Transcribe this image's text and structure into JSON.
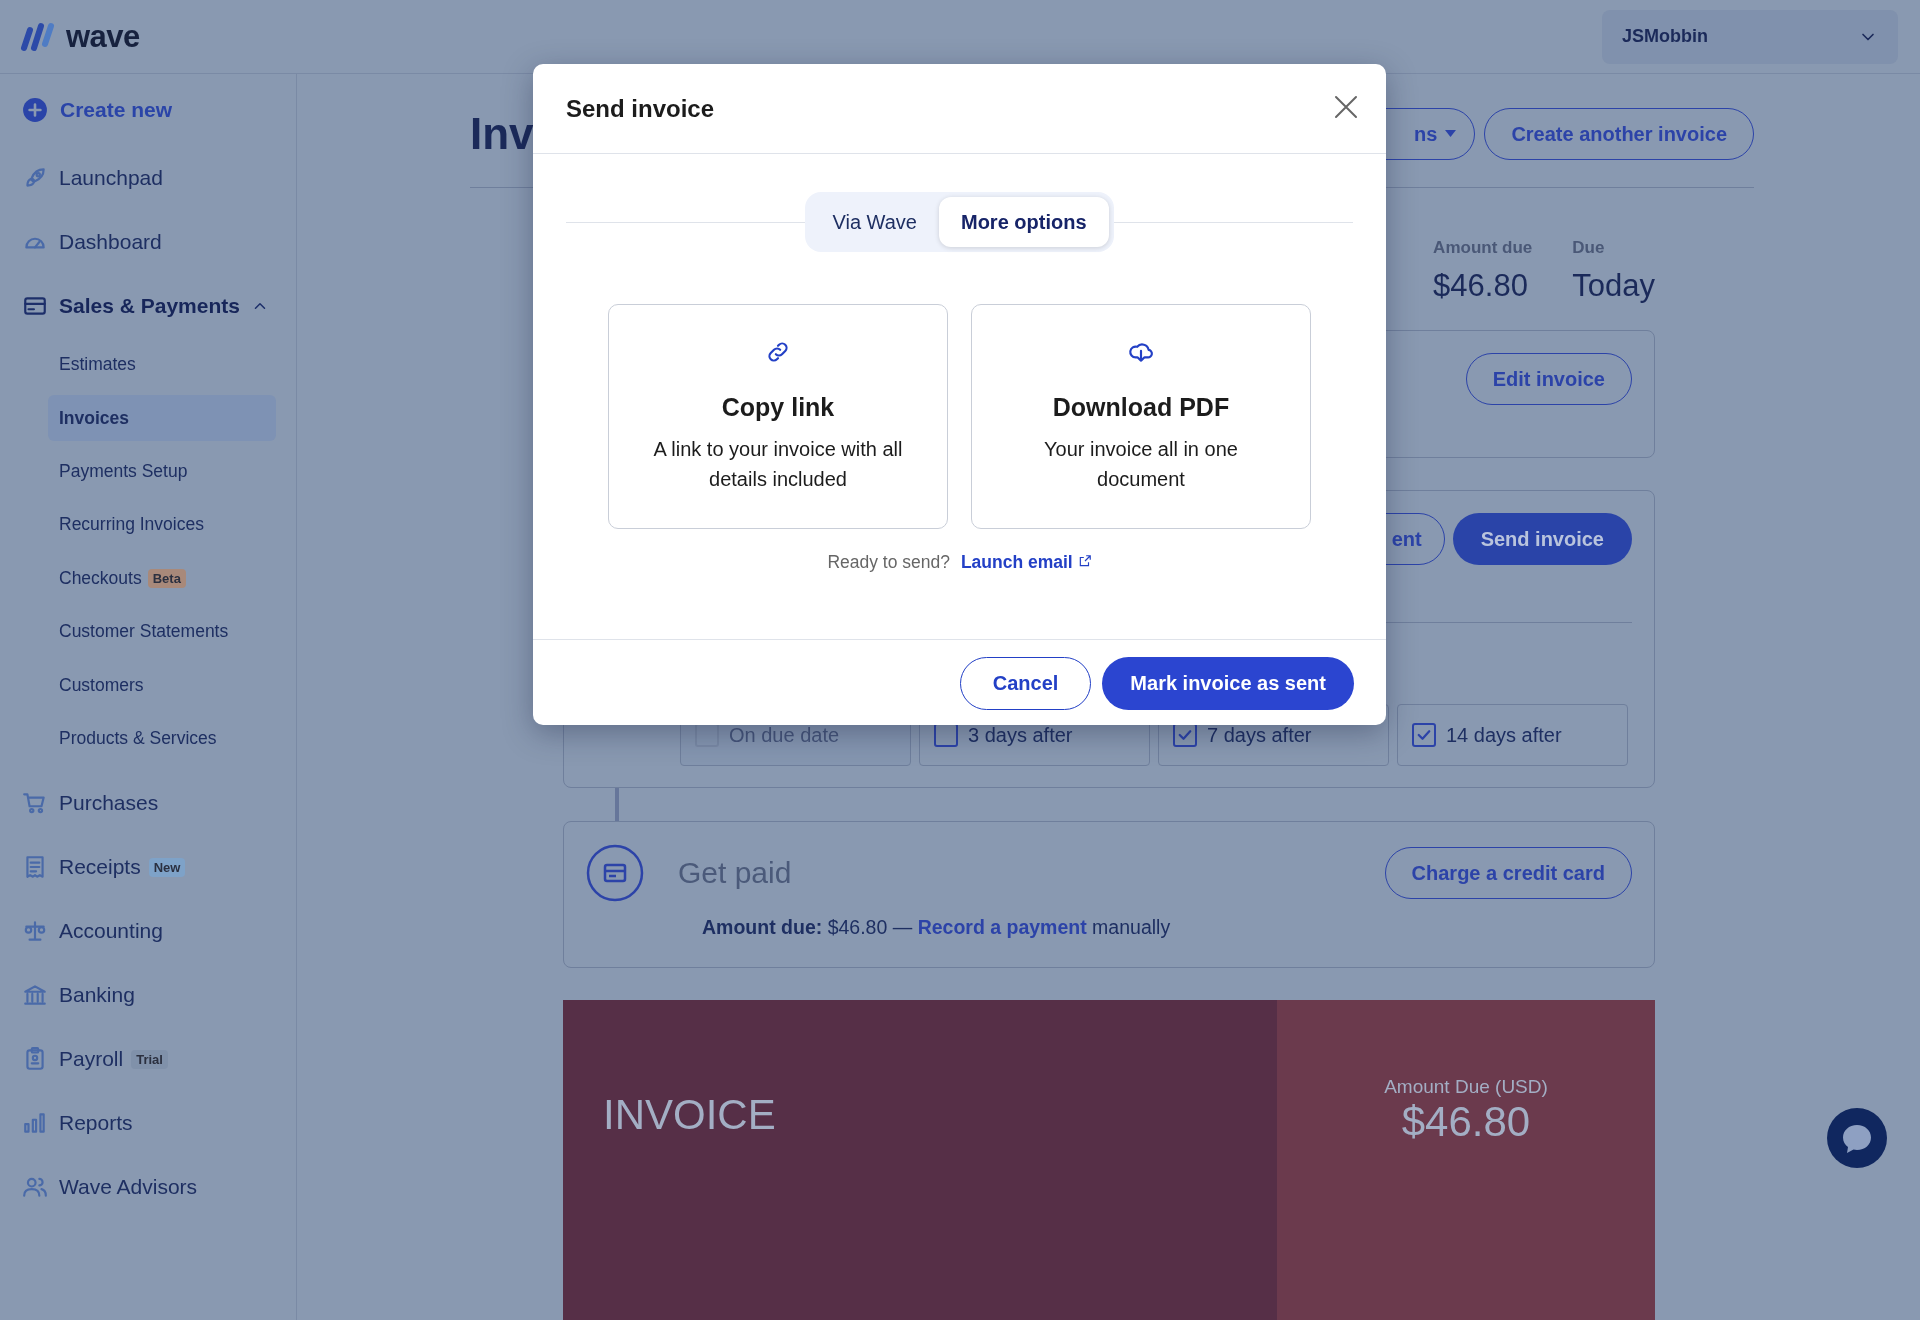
{
  "topbar": {
    "logo_text": "wave",
    "account": "JSMobbin"
  },
  "sidebar": {
    "create_new": "Create new",
    "items": [
      {
        "label": "Launchpad",
        "selected": false
      },
      {
        "label": "Dashboard",
        "selected": false
      },
      {
        "label": "Sales & Payments",
        "selected": true,
        "expanded": true,
        "children": [
          {
            "label": "Estimates",
            "selected": false
          },
          {
            "label": "Invoices",
            "selected": true
          },
          {
            "label": "Payments Setup",
            "selected": false
          },
          {
            "label": "Recurring Invoices",
            "selected": false
          },
          {
            "label": "Checkouts",
            "selected": false,
            "badge": {
              "text": "Beta",
              "color": "#a8897a"
            }
          },
          {
            "label": "Customer Statements",
            "selected": false
          },
          {
            "label": "Customers",
            "selected": false
          },
          {
            "label": "Products & Services",
            "selected": false
          }
        ]
      },
      {
        "label": "Purchases",
        "selected": false
      },
      {
        "label": "Receipts",
        "selected": false,
        "badge": {
          "text": "New",
          "color": "#7ea2c8"
        }
      },
      {
        "label": "Accounting",
        "selected": false
      },
      {
        "label": "Banking",
        "selected": false
      },
      {
        "label": "Payroll",
        "selected": false,
        "badge": {
          "text": "Trial",
          "color": "#8091aa"
        }
      },
      {
        "label": "Reports",
        "selected": false
      },
      {
        "label": "Wave Advisors",
        "selected": false
      }
    ]
  },
  "page": {
    "title": "Inv",
    "header_buttons": [
      {
        "label": "ns",
        "kind": "dropdown"
      },
      {
        "label": "Create another invoice",
        "kind": "outline"
      }
    ],
    "summary": [
      {
        "label": "Amount due",
        "value": "$46.80"
      },
      {
        "label": "Due",
        "value": "Today"
      }
    ],
    "edit_button": "Edit invoice",
    "send_buttons": [
      {
        "label": "ent",
        "kind": "outline"
      },
      {
        "label": "Send invoice",
        "kind": "primary"
      }
    ],
    "reminders": [
      {
        "label": "On due date",
        "checked": false,
        "disabled": true
      },
      {
        "label": "3 days after",
        "checked": false,
        "disabled": false
      },
      {
        "label": "7 days after",
        "checked": true,
        "disabled": false
      },
      {
        "label": "14 days after",
        "checked": true,
        "disabled": false
      }
    ],
    "get_paid": {
      "title": "Get paid",
      "button": "Charge a credit card",
      "amount_text": "**Amount due:** $46.80 —",
      "link": "Record a payment",
      "after_link": "manually"
    },
    "preview": {
      "title": "INVOICE",
      "amount_label": "Amount Due (USD)",
      "amount": "$46.80"
    }
  },
  "modal": {
    "title": "Send invoice",
    "tabs": [
      {
        "label": "Via Wave",
        "selected": false
      },
      {
        "label": "More options",
        "selected": true
      }
    ],
    "options": [
      {
        "title": "Copy link",
        "description": "A link to your invoice with all details included"
      },
      {
        "title": "Download PDF",
        "description": "Your invoice all in one document"
      }
    ],
    "prompt": "Ready to send?",
    "link": "Launch email",
    "buttons": [
      {
        "label": "Cancel",
        "kind": "outline"
      },
      {
        "label": "Mark invoice as sent",
        "kind": "primary"
      }
    ]
  }
}
